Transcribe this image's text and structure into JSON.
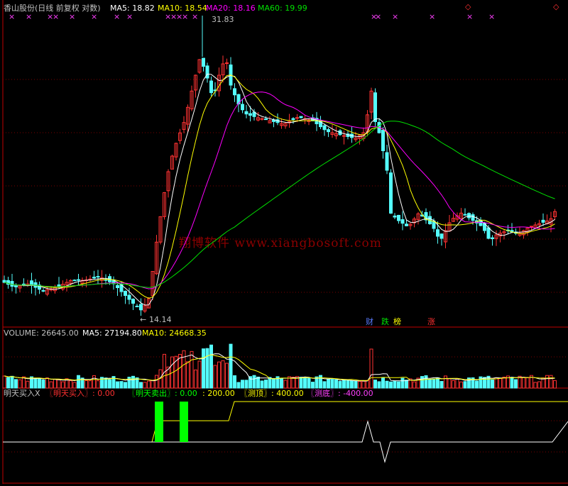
{
  "colors": {
    "bg": "#000000",
    "up": "#ff3232",
    "down": "#54fcfc",
    "ma5": "#ffffff",
    "ma10": "#ffff00",
    "ma20": "#ff00ff",
    "ma60": "#00e000",
    "grid": "#b00000",
    "frame": "#c00000",
    "text": "#c0c0c0",
    "buy": "#ff3030",
    "sell": "#00ff00",
    "top": "#ffff00",
    "bottom": "#ff40ff",
    "signal_line": "#ffff00",
    "bottom_line": "#ffffff",
    "watermark": "#8b0000"
  },
  "header": {
    "title": "香山股份(日线 前复权 对数)",
    "ma5": "MA5: 18.82",
    "ma10": "MA10: 18.54",
    "ma20": "MA20: 18.16",
    "ma60": "MA60: 19.99",
    "corner_left": "◇",
    "corner_right": "◇"
  },
  "price_panel": {
    "high_label": "31.83",
    "low_label": "14.14",
    "watermark": "翔博软件 www.xiangbosoft.com",
    "tags": [
      {
        "text": "财",
        "color": "#5a7bff"
      },
      {
        "text": "跌",
        "color": "#00e000"
      },
      {
        "text": "榜",
        "color": "#ffff00"
      },
      {
        "text": "涨",
        "color": "#ff3030"
      }
    ]
  },
  "volume_panel": {
    "volume": "VOLUME: 26645.00",
    "ma5": "MA5: 27194.80",
    "ma10": "MA10: 24668.35"
  },
  "indicator_panel": {
    "name": "明天买入X",
    "buy": "〖明天买入〗: 0.00",
    "sell": "〖明天卖出〗: 0.00",
    "sep": ": 200.00",
    "top": "〖测顶〗: 400.00",
    "bottom": "〖测底〗: -400.00"
  },
  "chart_data": [
    {
      "type": "candlestick",
      "title": "香山股份(日线 前复权 对数)",
      "ohlc": [],
      "ma": {
        "MA5": 18.82,
        "MA10": 18.54,
        "MA20": 18.16,
        "MA60": 19.99
      },
      "annotations": {
        "high": 31.83,
        "low": 14.14
      }
    },
    {
      "type": "bar",
      "series": [
        {
          "name": "VOLUME",
          "last": 26645.0
        }
      ],
      "ma": {
        "MA5": 27194.8,
        "MA10": 24668.35
      }
    },
    {
      "type": "line",
      "series": [
        {
          "name": "明天买入",
          "last": 0.0
        },
        {
          "name": "明天卖出",
          "last": 0.0
        },
        {
          "name": "测顶",
          "last": 400.0
        },
        {
          "name": "测底",
          "last": -400.0
        }
      ],
      "constant": 200.0
    }
  ]
}
